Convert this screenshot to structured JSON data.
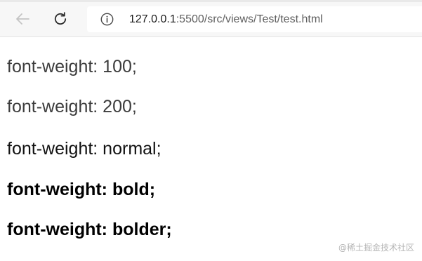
{
  "toolbar": {
    "back_icon": "arrow-left-icon",
    "reload_icon": "reload-icon",
    "info_icon": "info-circle-icon",
    "url_host": "127.0.0.1",
    "url_rest": ":5500/src/views/Test/test.html"
  },
  "page": {
    "lines": [
      "font-weight: 100;",
      "font-weight: 200;",
      "font-weight: normal;",
      "font-weight: bold;",
      "font-weight: bolder;"
    ]
  },
  "watermark": "@稀土掘金技术社区"
}
